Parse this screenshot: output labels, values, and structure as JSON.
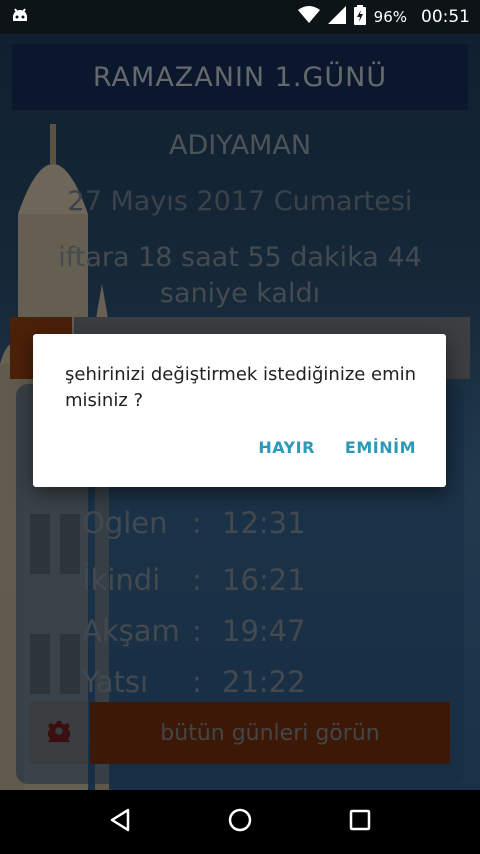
{
  "status_bar": {
    "battery": "96%",
    "time": "00:51"
  },
  "app": {
    "title": "RAMAZANIN  1.GÜNÜ",
    "city": "ADIYAMAN",
    "date": "27 Mayıs 2017 Cumartesi",
    "countdown": "iftara 18 saat 55 dakika 44 saniye kaldı",
    "prayer_times": [
      {
        "name": "Oglen",
        "sep": ":",
        "time": "12:31"
      },
      {
        "name": "İkindi",
        "sep": ":",
        "time": "16:21"
      },
      {
        "name": "Akşam",
        "sep": ":",
        "time": "19:47"
      },
      {
        "name": "Yatsı",
        "sep": ":",
        "time": "21:22"
      }
    ],
    "all_days_label": "bütün günleri görün"
  },
  "dialog": {
    "message": "şehirinizi değiştirmek istediğinize emin misiniz ?",
    "negative": "HAYIR",
    "positive": "EMİNİM"
  },
  "colors": {
    "accent": "#2a9ab8",
    "button_orange": "#b4501a"
  }
}
